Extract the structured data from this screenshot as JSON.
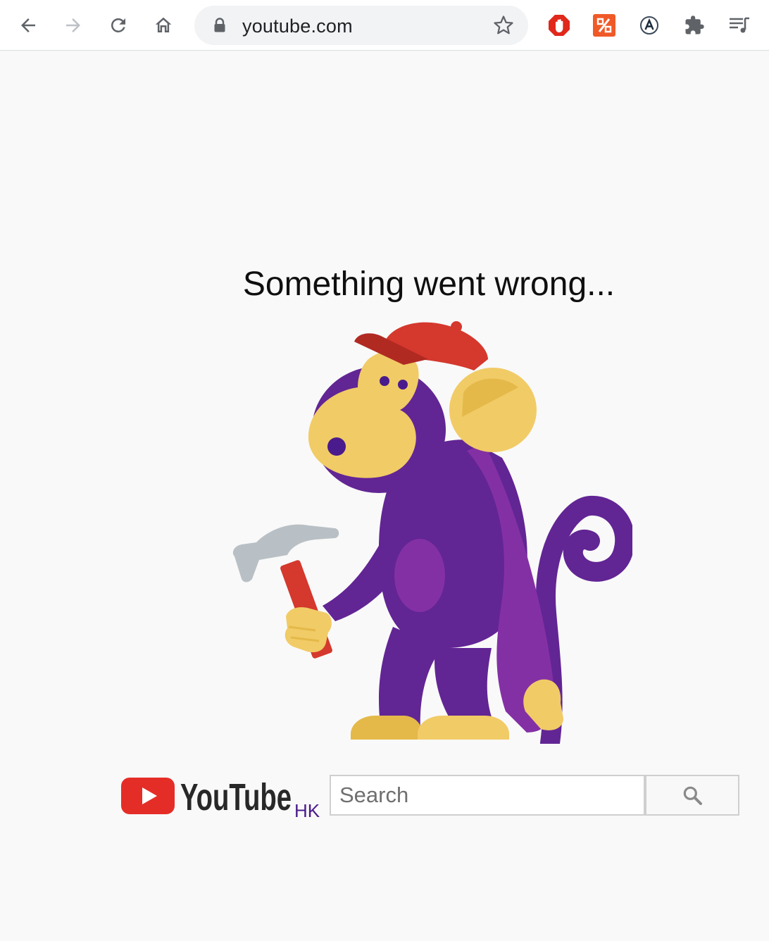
{
  "browser": {
    "url": "youtube.com",
    "back_icon": "arrow-left-icon",
    "forward_icon": "arrow-right-icon",
    "reload_icon": "reload-icon",
    "home_icon": "home-icon",
    "lock_icon": "lock-icon",
    "bookmark_icon": "star-icon",
    "extensions": [
      {
        "name": "adblock-extension-icon",
        "color": "#e0281b"
      },
      {
        "name": "percent-extension-icon",
        "color": "#f05a28"
      },
      {
        "name": "a-circle-extension-icon",
        "color": "#3b4a5a"
      },
      {
        "name": "puzzle-extensions-icon",
        "color": "#5f6368"
      },
      {
        "name": "media-queue-icon",
        "color": "#5f6368"
      }
    ]
  },
  "error": {
    "title": "Something went wrong..."
  },
  "brand": {
    "logo_text": "YouTube",
    "country": "HK",
    "logo_red": "#e52d27"
  },
  "search": {
    "placeholder": "Search",
    "value": "",
    "button_icon": "magnifier-icon"
  },
  "colors": {
    "monkey_purple": "#622594",
    "monkey_purple_light": "#8430a5",
    "monkey_yellow": "#f1cb66",
    "monkey_yellow_dark": "#e4b949",
    "cap_red": "#d5382d",
    "hammer_gray": "#b9c0c5"
  }
}
